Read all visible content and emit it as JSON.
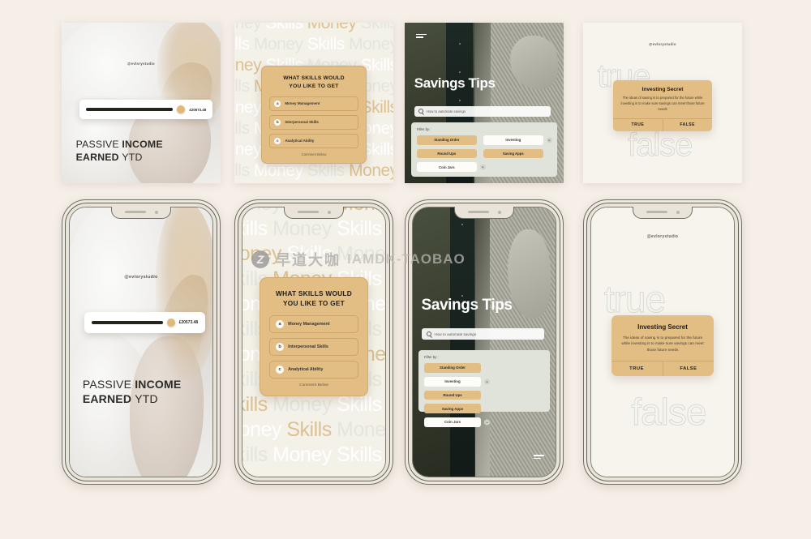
{
  "page": {
    "background_color": "#f6efe8",
    "accent_tan": "#e2bd84",
    "accent_sage": "#dfe3da"
  },
  "watermark": {
    "logo_letter": "Z",
    "chinese_text": "早道大咖",
    "latin_text": "IAMDK-TAOBAO"
  },
  "scene1": {
    "name": "Passive income earned YTD post",
    "handle": "@evlorystudio",
    "slider_value": "£20573.48",
    "headline_line1_light": "PASSIVE ",
    "headline_line1_bold": "INCOME",
    "headline_line2_bold": "EARNED ",
    "headline_line2_light": "YTD"
  },
  "scene2": {
    "name": "Money Skills quiz post",
    "bg_word_a": "Money",
    "bg_word_b": "Skills",
    "title_line1": "WHAT SKILLS WOULD",
    "title_line2": "YOU LIKE TO GET",
    "options": [
      {
        "key": "a",
        "label": "Money Management"
      },
      {
        "key": "b",
        "label": "Interpersonal Skills"
      },
      {
        "key": "c",
        "label": "Analytical Ability"
      }
    ],
    "footer": "Comment Below"
  },
  "scene3": {
    "name": "Savings Tips post",
    "title": "Savings Tips",
    "search_placeholder": "How to automate savings",
    "filter_label": "Filter by :",
    "chips": [
      {
        "label": "Standing Order",
        "style": "fill",
        "removable": false
      },
      {
        "label": "Investing",
        "style": "out",
        "removable": true
      },
      {
        "label": "Round Ups",
        "style": "fill",
        "removable": false
      },
      {
        "label": "Saving Apps",
        "style": "fill",
        "removable": false
      },
      {
        "label": "Coin Jars",
        "style": "out",
        "removable": true
      }
    ],
    "chip_remove_glyph": "×"
  },
  "scene4": {
    "name": "Investing Secret true-false post",
    "handle": "@evlorystudio",
    "ghost_true": "true",
    "ghost_false": "false",
    "card_title": "Investing Secret",
    "card_body": "The ideas of saving is to prepared for the future while investing is to make sure savings can meet those future needs",
    "button_true": "TRUE",
    "button_false": "FALSE"
  }
}
